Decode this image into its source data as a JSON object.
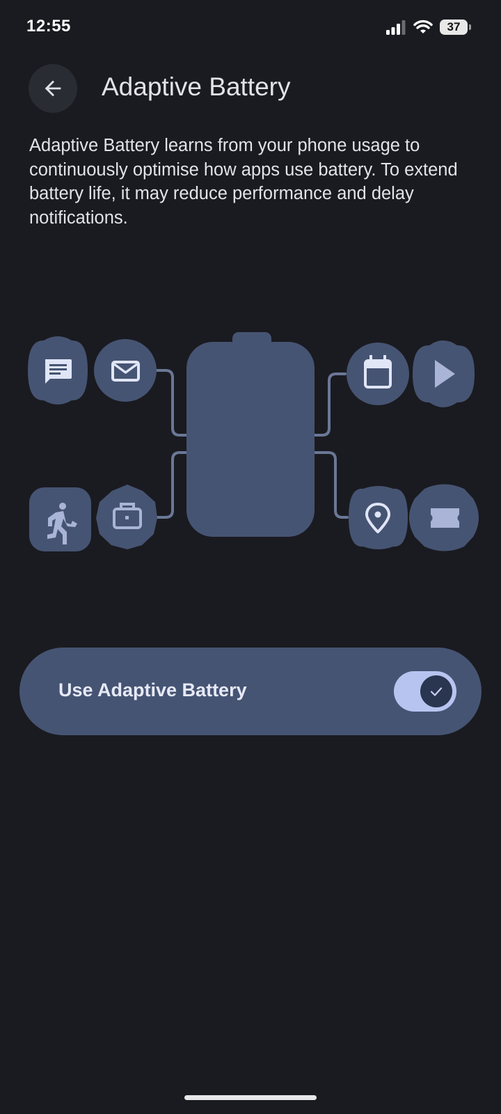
{
  "status_bar": {
    "time": "12:55",
    "battery_level": "37",
    "signal_icon": "cellular-signal-icon",
    "wifi_icon": "wifi-icon"
  },
  "header": {
    "back_icon": "arrow-back-icon",
    "title": "Adaptive Battery"
  },
  "description": "Adaptive Battery learns from your phone usage to continuously optimise how apps use battery. To extend battery life, it may reduce performance and delay notifications.",
  "illustration": {
    "center_icon": "battery-icon",
    "left_icons": [
      "message-icon",
      "mail-icon",
      "walking-icon",
      "briefcase-icon"
    ],
    "right_icons": [
      "calendar-icon",
      "play-icon",
      "location-pin-icon",
      "ticket-icon"
    ]
  },
  "settings": {
    "adaptive_battery": {
      "label": "Use Adaptive Battery",
      "enabled": true,
      "check_icon": "check-icon"
    }
  },
  "colors": {
    "background": "#1a1b20",
    "card": "#465473",
    "switch_track": "#b8c4f0",
    "switch_thumb": "#2a3550",
    "illustration_icon": "#e0e5f7"
  }
}
